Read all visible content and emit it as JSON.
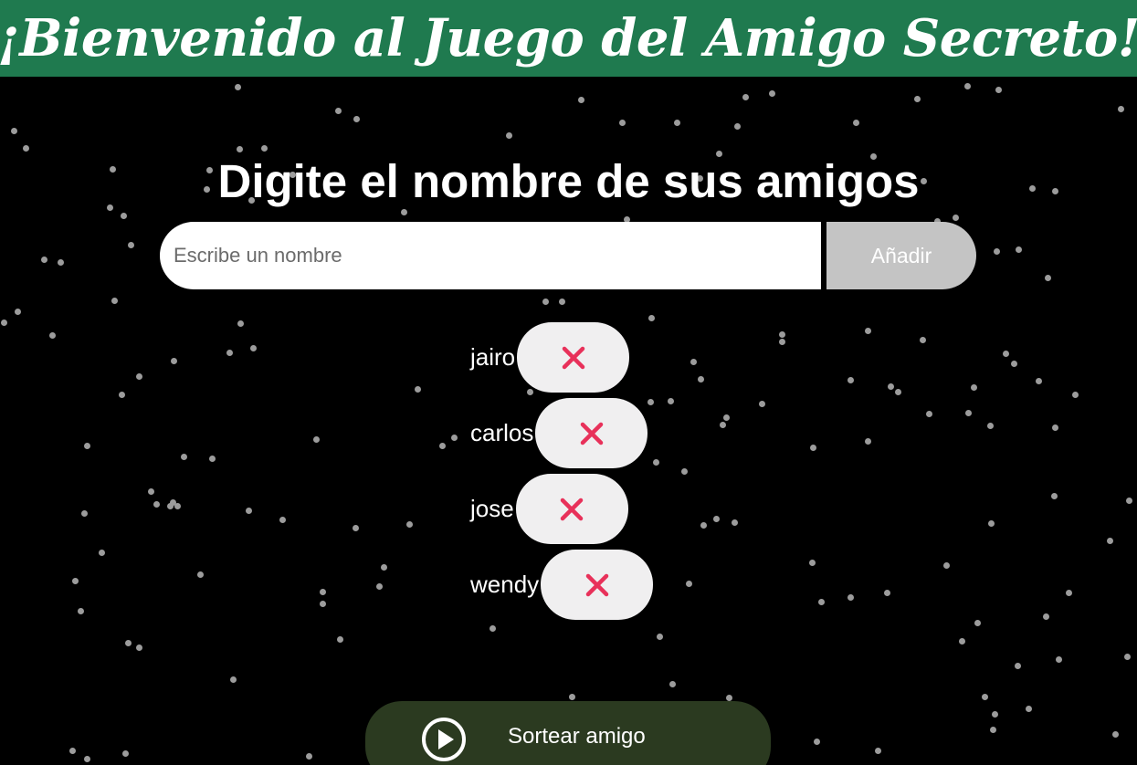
{
  "header": {
    "title": "¡Bienvenido al Juego del Amigo Secreto!",
    "left_icon": "gift-icon",
    "right_icon": "party-popper-icon",
    "background_color": "#1f7a4f"
  },
  "main": {
    "title": "Digite el nombre de sus amigos",
    "input": {
      "placeholder": "Escribe un nombre",
      "value": ""
    },
    "add_button_label": "Añadir",
    "friends": [
      {
        "name": "jairo",
        "remove_icon": "close-icon"
      },
      {
        "name": "carlos",
        "remove_icon": "close-icon"
      },
      {
        "name": "jose",
        "remove_icon": "close-icon"
      },
      {
        "name": "wendy",
        "remove_icon": "close-icon"
      }
    ],
    "draw_button": {
      "label": "Sortear amigo",
      "icon": "play-circle-icon"
    }
  },
  "colors": {
    "background": "#000000",
    "add_button": "#c4c4c4",
    "remove_icon": "#e8315a",
    "draw_button": "#2b3a20"
  }
}
